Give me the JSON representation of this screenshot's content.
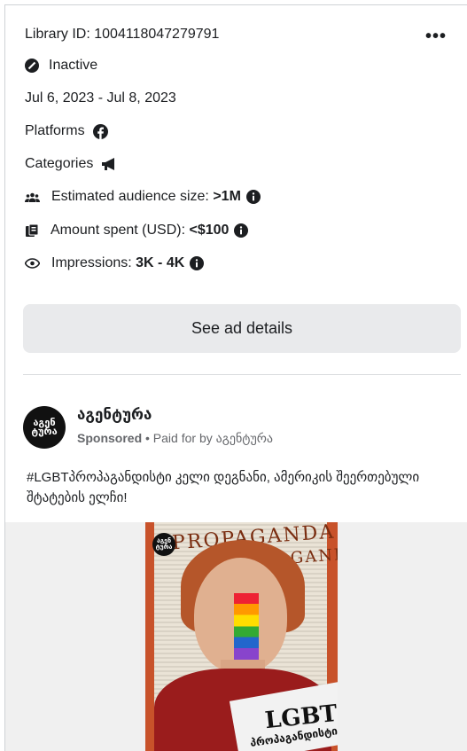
{
  "ad": {
    "library_id": "Library ID: 1004118047279791",
    "more_icon": "more-horizontal-icon",
    "status": "Inactive",
    "status_icon": "inactive-icon",
    "date_range": "Jul 6, 2023 - Jul 8, 2023",
    "platforms_label": "Platforms",
    "platform_icon": "facebook-icon",
    "categories_label": "Categories",
    "category_icon": "megaphone-icon",
    "audience_label": "Estimated audience size: ",
    "audience_value": ">1M",
    "spent_label": "Amount spent (USD): ",
    "spent_value": "<$100",
    "impressions_label": "Impressions: ",
    "impressions_value": "3K - 4K",
    "details_button": "See ad details"
  },
  "post": {
    "page_name": "აგენტურა",
    "avatar_text": "აგენ ტურა",
    "sponsored": "Sponsored",
    "paid_for": " • Paid for by აგენტურა",
    "text": "#LGBTპროპაგანდისტი კელი დეგნანი, ამერიკის შეერთებული შტატების ელჩი!"
  },
  "media": {
    "poster_bg_word": "PROPAGANDA",
    "poster_title": "LGBT",
    "poster_subtitle": "პროპაგანდისტი",
    "poster_badge": "აგენ ტურა"
  },
  "colors": {
    "text": "#1c1e21",
    "secondary": "#65676b",
    "button_bg": "#e9eaec",
    "poster_orange": "#c8522a"
  }
}
